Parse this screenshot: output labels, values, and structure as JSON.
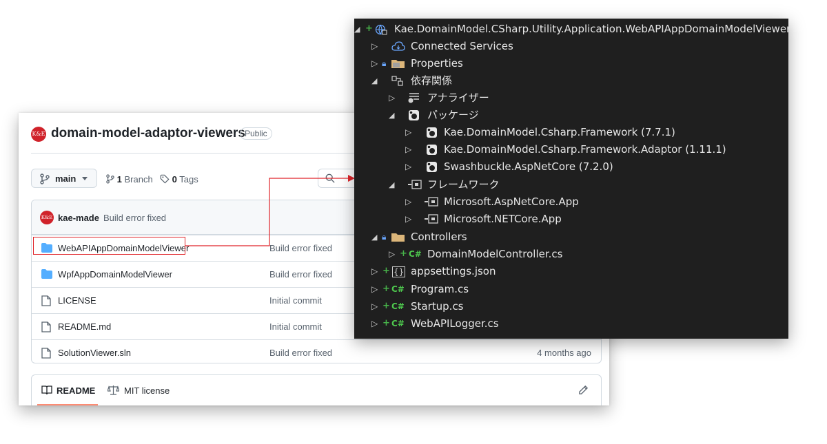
{
  "github": {
    "repo_name": "domain-model-adaptor-viewers",
    "visibility": "Public",
    "branch": "main",
    "branch_count": "1",
    "branch_label": "Branch",
    "tag_count": "0",
    "tag_label": "Tags",
    "latest_commit": {
      "author": "kae-made",
      "message": "Build error fixed"
    },
    "files": [
      {
        "name": "WebAPIAppDomainModelViewer",
        "type": "folder",
        "message": "Build error fixed",
        "date": ""
      },
      {
        "name": "WpfAppDomainModelViewer",
        "type": "folder",
        "message": "Build error fixed",
        "date": ""
      },
      {
        "name": "LICENSE",
        "type": "file",
        "message": "Initial commit",
        "date": ""
      },
      {
        "name": "README.md",
        "type": "file",
        "message": "Initial commit",
        "date": ""
      },
      {
        "name": "SolutionViewer.sln",
        "type": "file",
        "message": "Build error fixed",
        "date": "4 months ago"
      }
    ],
    "readme_tab": "README",
    "license_tab": "MIT license",
    "logo_text": "K&E"
  },
  "solution_explorer": {
    "items": [
      {
        "label": "Kae.DomainModel.CSharp.Utility.Application.WebAPIAppDomainModelViewer",
        "icon": "web-project-icon"
      },
      {
        "label": "Connected Services",
        "icon": "cloud-icon"
      },
      {
        "label": "Properties",
        "icon": "properties-folder-icon"
      },
      {
        "label": "依存関係",
        "icon": "dependencies-icon"
      },
      {
        "label": "アナライザー",
        "icon": "analyzer-icon"
      },
      {
        "label": "パッケージ",
        "icon": "package-icon"
      },
      {
        "label": "Kae.DomainModel.Csharp.Framework (7.7.1)",
        "icon": "package-icon"
      },
      {
        "label": "Kae.DomainModel.Csharp.Framework.Adaptor (1.11.1)",
        "icon": "package-icon"
      },
      {
        "label": "Swashbuckle.AspNetCore (7.2.0)",
        "icon": "package-icon"
      },
      {
        "label": "フレームワーク",
        "icon": "framework-icon"
      },
      {
        "label": "Microsoft.AspNetCore.App",
        "icon": "framework-icon"
      },
      {
        "label": "Microsoft.NETCore.App",
        "icon": "framework-icon"
      },
      {
        "label": "Controllers",
        "icon": "folder-icon"
      },
      {
        "label": "DomainModelController.cs",
        "icon": "csharp-icon"
      },
      {
        "label": "appsettings.json",
        "icon": "json-icon"
      },
      {
        "label": "Program.cs",
        "icon": "csharp-icon"
      },
      {
        "label": "Startup.cs",
        "icon": "csharp-icon"
      },
      {
        "label": "WebAPILogger.cs",
        "icon": "csharp-icon"
      }
    ]
  },
  "colors": {
    "annotation_red": "#e0242a",
    "vs_background": "#1f1f1f",
    "github_link": "#1f2328"
  }
}
